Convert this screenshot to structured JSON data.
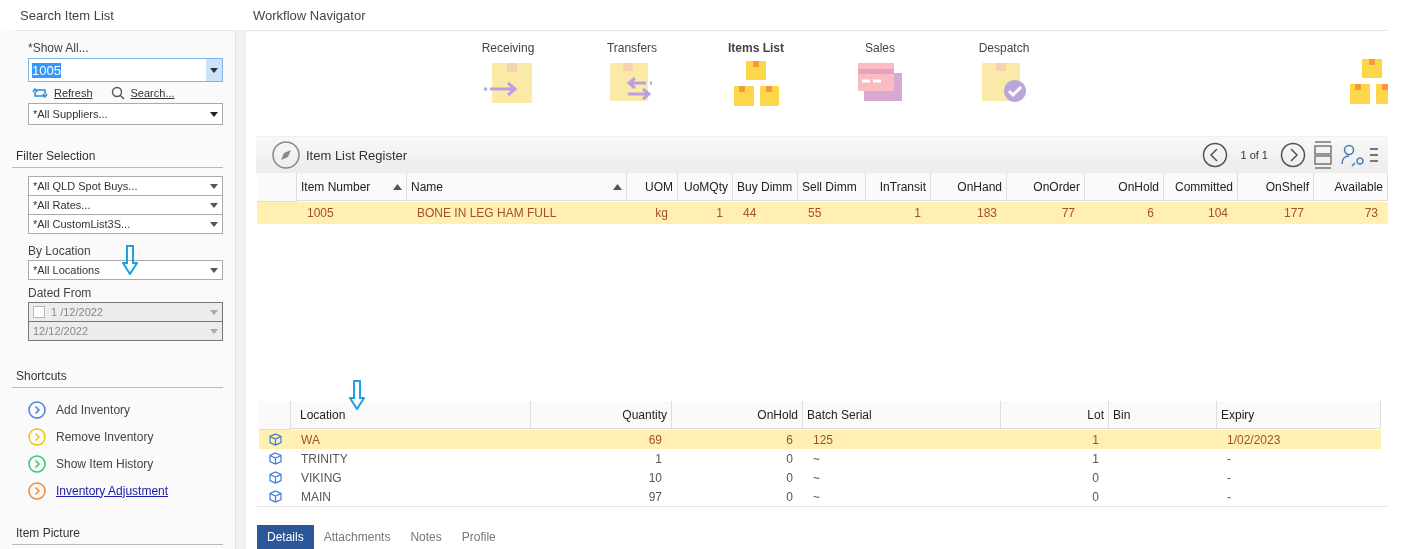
{
  "search_panel": {
    "title": "Search Item List",
    "show_all_label": "*Show All...",
    "item_field": {
      "value": "1005"
    },
    "refresh_link": "Refresh",
    "search_link": "Search...",
    "supplier_select": "*All Suppliers...",
    "filter_title": "Filter Selection",
    "filter_selects": [
      "*All QLD Spot Buys...",
      "*All Rates...",
      "*All CustomList3S..."
    ],
    "by_location_label": "By Location",
    "location_select": "*All Locations",
    "dated_from_label": "Dated From",
    "date_from": {
      "value": "1 /12/2022",
      "checked": false
    },
    "date_to": {
      "value": "12/12/2022"
    },
    "shortcuts_title": "Shortcuts",
    "shortcuts": [
      {
        "label": "Add Inventory",
        "color": "#4a7ee8",
        "link": false
      },
      {
        "label": "Remove Inventory",
        "color": "#f2c40f",
        "link": false
      },
      {
        "label": "Show Item History",
        "color": "#3cc46a",
        "link": false
      },
      {
        "label": "Inventory Adjustment",
        "color": "#ee8a3a",
        "link": true
      }
    ],
    "item_picture_title": "Item Picture"
  },
  "workflow": {
    "title": "Workflow Navigator",
    "items": [
      {
        "kind": "receiving",
        "label": "Receiving",
        "selected": false
      },
      {
        "kind": "transfers",
        "label": "Transfers",
        "selected": false
      },
      {
        "kind": "items",
        "label": "Items List",
        "selected": true
      },
      {
        "kind": "sales",
        "label": "Sales",
        "selected": false
      },
      {
        "kind": "despatch",
        "label": "Despatch",
        "selected": false
      }
    ]
  },
  "register": {
    "title": "Item List Register",
    "page": "1 of 1",
    "columns": [
      {
        "label": "Item Number",
        "sorted": true
      },
      {
        "label": "Name",
        "sorted": true
      },
      {
        "label": "UOM",
        "sorted": false
      },
      {
        "label": "UoMQty",
        "sorted": false
      },
      {
        "label": "Buy Dimm",
        "sorted": false
      },
      {
        "label": "Sell Dimm",
        "sorted": false
      },
      {
        "label": "InTransit",
        "sorted": false
      },
      {
        "label": "OnHand",
        "sorted": false
      },
      {
        "label": "OnOrder",
        "sorted": false
      },
      {
        "label": "OnHold",
        "sorted": false
      },
      {
        "label": "Committed",
        "sorted": false
      },
      {
        "label": "OnShelf",
        "sorted": false
      },
      {
        "label": "Available",
        "sorted": false
      }
    ],
    "rows": [
      {
        "selected": true,
        "cells": [
          "1005",
          "BONE IN LEG HAM FULL",
          "kg",
          "1",
          "44",
          "55",
          "1",
          "183",
          "77",
          "6",
          "104",
          "177",
          "73"
        ]
      }
    ]
  },
  "locations": {
    "columns": [
      "Location",
      "Quantity",
      "OnHold",
      "Batch Serial",
      "Lot",
      "Bin",
      "Expiry"
    ],
    "rows": [
      {
        "selected": true,
        "cells": [
          "WA",
          "69",
          "6",
          "125",
          "1",
          "",
          "1/02/2023"
        ]
      },
      {
        "selected": false,
        "cells": [
          "TRINITY",
          "1",
          "0",
          "~",
          "1",
          "",
          "-"
        ]
      },
      {
        "selected": false,
        "cells": [
          "VIKING",
          "10",
          "0",
          "~",
          "0",
          "",
          "-"
        ]
      },
      {
        "selected": false,
        "cells": [
          "MAIN",
          "97",
          "0",
          "~",
          "0",
          "",
          "-"
        ]
      }
    ]
  },
  "tabs": [
    {
      "label": "Details",
      "selected": true
    },
    {
      "label": "Attachments",
      "selected": false
    },
    {
      "label": "Notes",
      "selected": false
    },
    {
      "label": "Profile",
      "selected": false
    }
  ]
}
